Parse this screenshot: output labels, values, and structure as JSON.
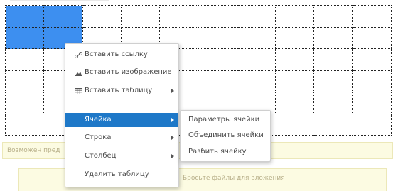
{
  "table": {
    "rows": 5,
    "cols": 10
  },
  "context_menu": {
    "items": [
      {
        "label": "Вставить ссылку",
        "icon": "link-icon",
        "submenu": false
      },
      {
        "label": "Вставить изображение",
        "icon": "image-icon",
        "submenu": false
      },
      {
        "label": "Вставить таблицу",
        "icon": "table-icon",
        "submenu": true
      },
      {
        "label": "Ячейка",
        "submenu": true,
        "active": true
      },
      {
        "label": "Строка",
        "submenu": true
      },
      {
        "label": "Столбец",
        "submenu": true
      },
      {
        "label": "Удалить таблицу",
        "submenu": false
      }
    ]
  },
  "cell_submenu": {
    "items": [
      {
        "label": "Параметры ячейки"
      },
      {
        "label": "Объединить ячейки"
      },
      {
        "label": "Разбить ячейку"
      }
    ]
  },
  "hint_text": "Возможен пред",
  "upload_text": "Бросьте файлы для вложения",
  "colors": {
    "selection": "#3d8ff0",
    "menu_active": "#1e78c8",
    "hint_bg": "#fcfbe2"
  }
}
